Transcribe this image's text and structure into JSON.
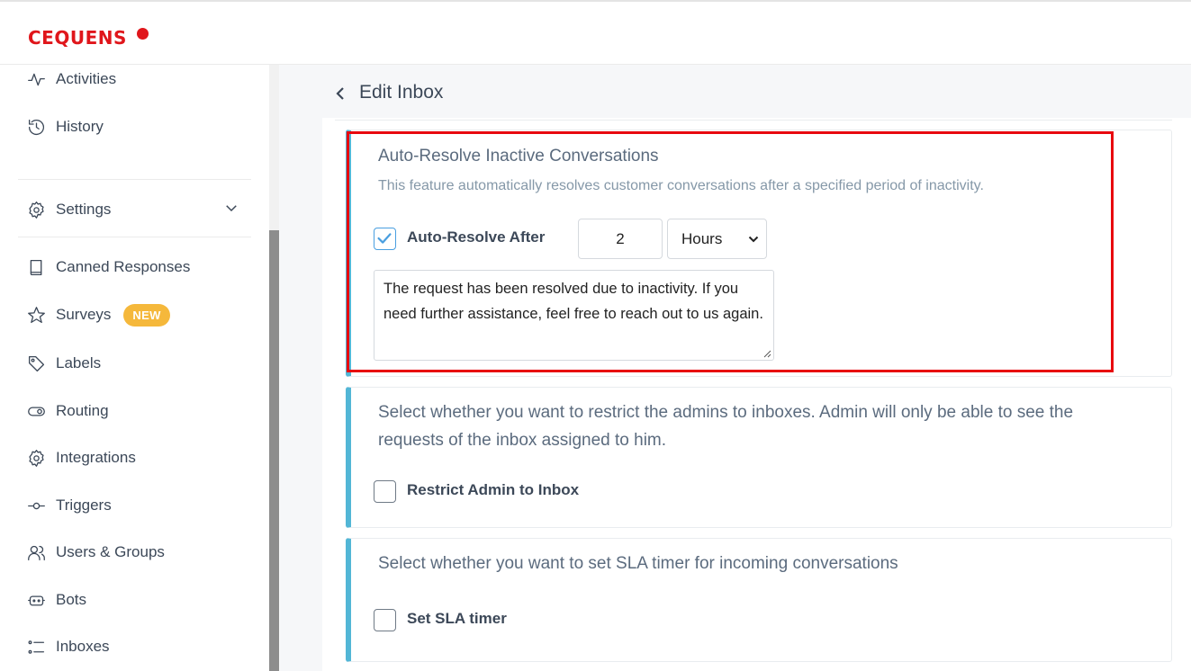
{
  "brand": {
    "name": "CEQUENS",
    "color": "#e0161b"
  },
  "sidebar": {
    "items": [
      {
        "label": "Activities",
        "icon": "activity-icon"
      },
      {
        "label": "History",
        "icon": "history-icon"
      },
      {
        "label": "Settings",
        "icon": "gear-icon"
      },
      {
        "label": "Canned Responses",
        "icon": "book-icon"
      },
      {
        "label": "Surveys",
        "icon": "star-icon",
        "badge": "NEW"
      },
      {
        "label": "Labels",
        "icon": "tag-icon"
      },
      {
        "label": "Routing",
        "icon": "toggle-icon"
      },
      {
        "label": "Integrations",
        "icon": "gear-icon"
      },
      {
        "label": "Triggers",
        "icon": "trigger-icon"
      },
      {
        "label": "Users & Groups",
        "icon": "users-icon"
      },
      {
        "label": "Bots",
        "icon": "bot-icon"
      },
      {
        "label": "Inboxes",
        "icon": "list-icon"
      }
    ]
  },
  "header": {
    "title": "Edit Inbox"
  },
  "auto_resolve": {
    "title": "Auto-Resolve Inactive Conversations",
    "description": "This feature automatically resolves customer conversations after a specified period of inactivity.",
    "checkbox_label": "Auto-Resolve After",
    "checked": true,
    "amount": "2",
    "unit": "Hours",
    "message": "The request has been resolved due to inactivity. If you need further assistance, feel free to reach out to us again."
  },
  "restrict_admin": {
    "description": "Select whether you want to restrict the admins to inboxes. Admin will only be able to see the requests of the inbox assigned to him.",
    "checkbox_label": "Restrict Admin to Inbox",
    "checked": false
  },
  "sla": {
    "description": "Select whether you want to set SLA timer for incoming conversations",
    "checkbox_label": "Set SLA timer",
    "checked": false
  },
  "colors": {
    "accent": "#52b6d6",
    "highlight": "#e8090f",
    "badge": "#f5b83b"
  }
}
